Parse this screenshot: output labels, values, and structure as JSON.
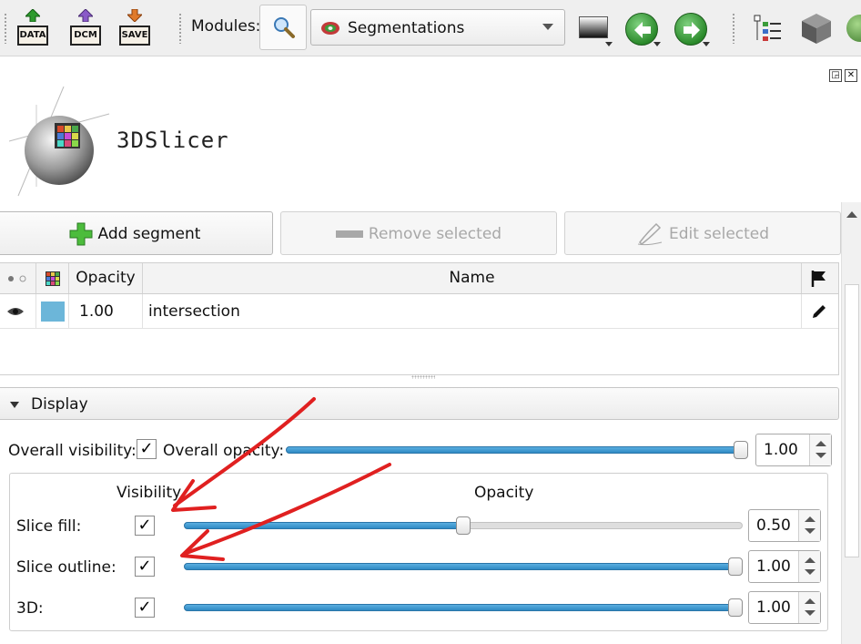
{
  "toolbar": {
    "data_label": "DATA",
    "dcm_label": "DCM",
    "save_label": "SAVE",
    "modules_label": "Modules:",
    "module_selected": "Segmentations",
    "search_icon": "search-icon",
    "back_icon": "arrow-left-icon",
    "forward_icon": "arrow-right-icon"
  },
  "logo": {
    "text": "3DSlicer"
  },
  "buttons": {
    "add": "Add segment",
    "remove": "Remove selected",
    "edit": "Edit selected"
  },
  "table": {
    "columns": [
      "Opacity",
      "Name"
    ],
    "rows": [
      {
        "color": "#6cb6d9",
        "opacity": "1.00",
        "name": "intersection"
      }
    ]
  },
  "display": {
    "title": "Display",
    "overall_visibility_label": "Overall visibility:",
    "overall_visibility_checked": true,
    "overall_opacity_label": "Overall opacity:",
    "overall_opacity": "1.00",
    "overall_opacity_fraction": 1.0,
    "col_visibility": "Visibility",
    "col_opacity": "Opacity",
    "rows": [
      {
        "label": "Slice fill:",
        "checked": true,
        "value": "0.50",
        "fraction": 0.5
      },
      {
        "label": "Slice outline:",
        "checked": true,
        "value": "1.00",
        "fraction": 1.0
      },
      {
        "label": "3D:",
        "checked": true,
        "value": "1.00",
        "fraction": 1.0
      }
    ]
  },
  "colors": {
    "accent_blue": "#2f8ac4",
    "segment_color": "#6cb6d9",
    "annotation_red": "#e02020"
  }
}
